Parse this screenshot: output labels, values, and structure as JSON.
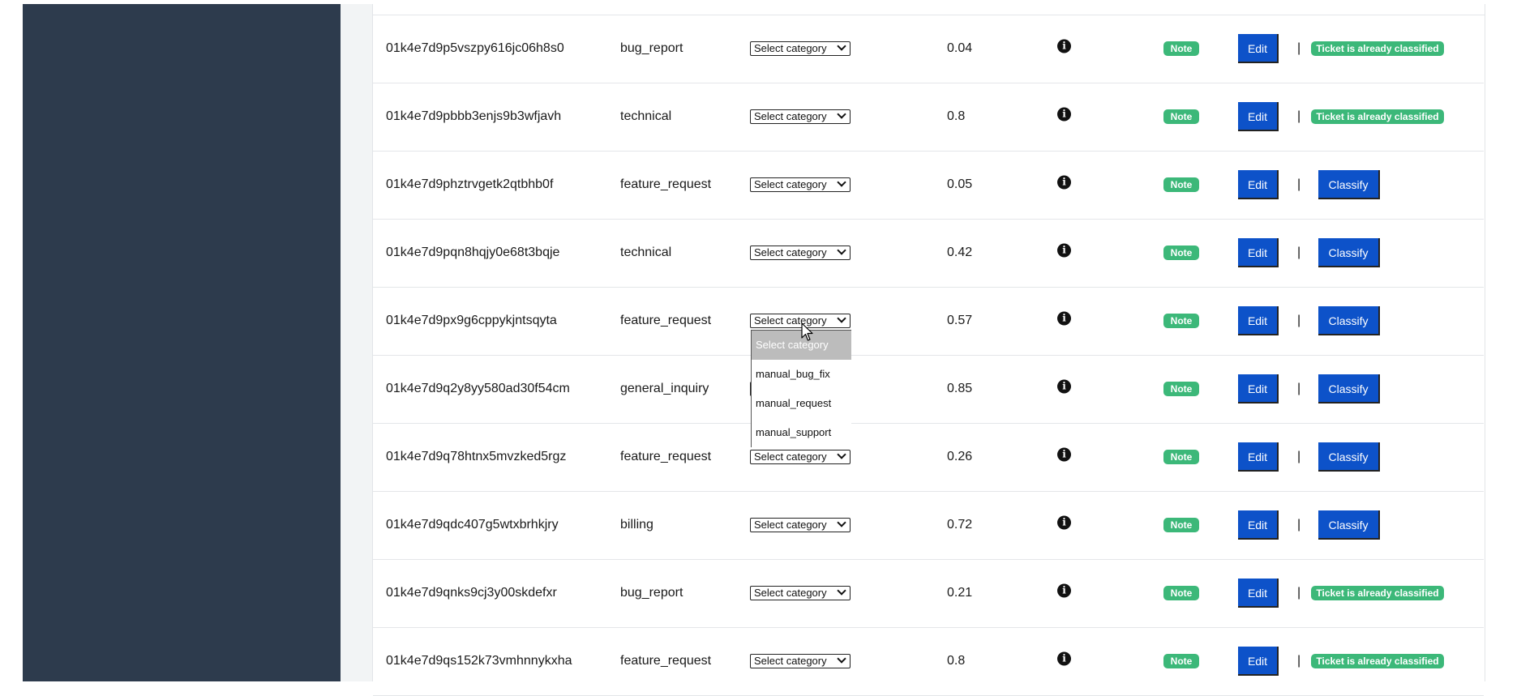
{
  "select_placeholder": "Select category",
  "actions": {
    "note_label": "Note",
    "edit_label": "Edit",
    "separator": "|",
    "classify_label": "Classify",
    "classified_label": "Ticket is already classified"
  },
  "info_glyph": "i",
  "icons": {
    "info": "info-circle-icon",
    "dropdown": "chevron-down-icon",
    "cursor": "mouse-pointer-icon"
  },
  "colors": {
    "sidebar": "#2d3b4d",
    "primary_button": "#0d52c9",
    "success_badge": "#3cb879"
  },
  "rows": [
    {
      "id": "01k4e7d9p5vszpy616jc06h8s0",
      "category": "bug_report",
      "score": "0.04",
      "classified": true
    },
    {
      "id": "01k4e7d9pbbb3enjs9b3wfjavh",
      "category": "technical",
      "score": "0.8",
      "classified": true
    },
    {
      "id": "01k4e7d9phztrvgetk2qtbhb0f",
      "category": "feature_request",
      "score": "0.05",
      "classified": false
    },
    {
      "id": "01k4e7d9pqn8hqjy0e68t3bqje",
      "category": "technical",
      "score": "0.42",
      "classified": false
    },
    {
      "id": "01k4e7d9px9g6cppykjntsqyta",
      "category": "feature_request",
      "score": "0.57",
      "classified": false
    },
    {
      "id": "01k4e7d9q2y8yy580ad30f54cm",
      "category": "general_inquiry",
      "score": "0.85",
      "classified": false
    },
    {
      "id": "01k4e7d9q78htnx5mvzked5rgz",
      "category": "feature_request",
      "score": "0.26",
      "classified": false
    },
    {
      "id": "01k4e7d9qdc407g5wtxbrhkjry",
      "category": "billing",
      "score": "0.72",
      "classified": false
    },
    {
      "id": "01k4e7d9qnks9cj3y00skdefxr",
      "category": "bug_report",
      "score": "0.21",
      "classified": true
    },
    {
      "id": "01k4e7d9qs152k73vmhnnykxha",
      "category": "feature_request",
      "score": "0.8",
      "classified": true
    }
  ],
  "open_dropdown": {
    "row_index": 4,
    "options": [
      "Select category",
      "manual_bug_fix",
      "manual_request",
      "manual_support"
    ],
    "highlighted_index": 0
  }
}
